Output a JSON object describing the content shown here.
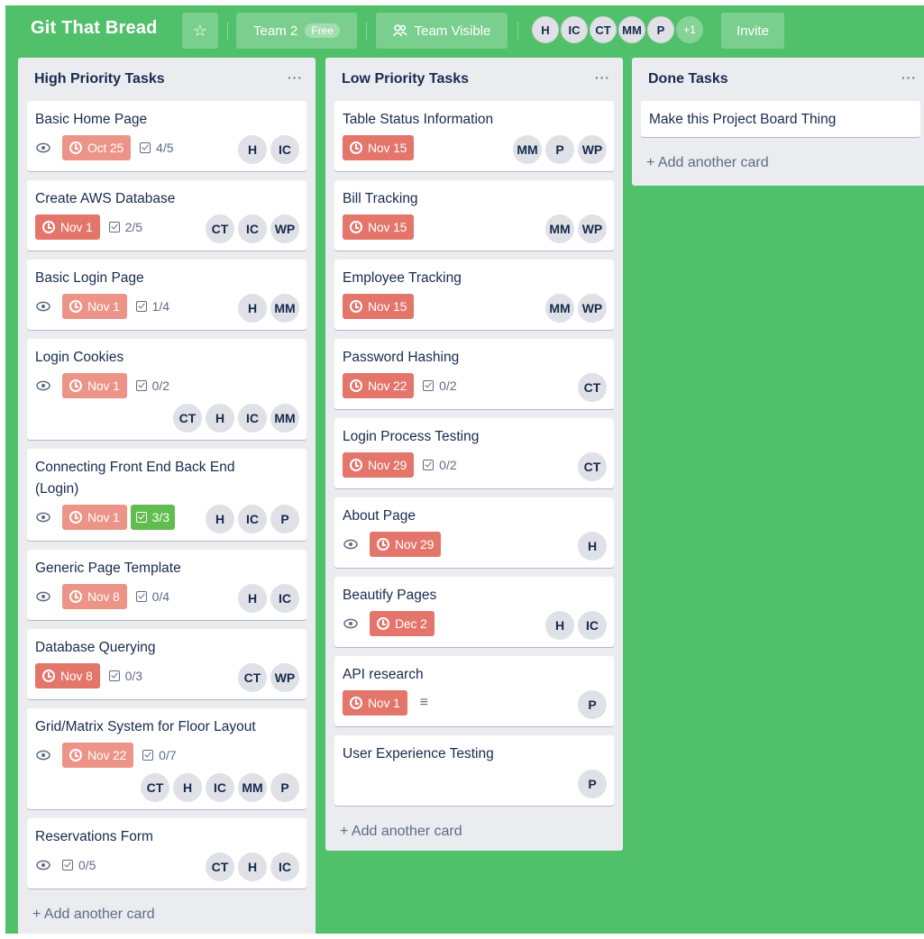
{
  "header": {
    "title": "Git That Bread",
    "team_label": "Team 2",
    "team_badge": "Free",
    "visibility_label": "Team Visible",
    "members": [
      "H",
      "IC",
      "CT",
      "MM",
      "P"
    ],
    "more_members": "+1",
    "invite_label": "Invite"
  },
  "lists": [
    {
      "title": "High Priority Tasks",
      "menu": "···",
      "add_card": "+ Add another card",
      "cards": [
        {
          "title": "Basic Home Page",
          "due": "Oct 25",
          "checklist": "4/5",
          "members": [
            "H",
            "IC"
          ]
        },
        {
          "title": "Create AWS Database",
          "due": "Nov 1",
          "checklist": "2/5",
          "members": [
            "CT",
            "IC",
            "WP"
          ]
        },
        {
          "title": "Basic Login Page",
          "due": "Nov 1",
          "checklist": "1/4",
          "members": [
            "H",
            "MM"
          ]
        },
        {
          "title": "Login Cookies",
          "due": "Nov 1",
          "checklist": "0/2",
          "members": [
            "CT",
            "H",
            "IC",
            "MM"
          ]
        },
        {
          "title": "Connecting Front End Back End (Login)",
          "due": "Nov 1",
          "checklist": "3/3",
          "members": [
            "H",
            "IC",
            "P"
          ]
        },
        {
          "title": "Generic Page Template",
          "due": "Nov 8",
          "checklist": "0/4",
          "members": [
            "H",
            "IC"
          ]
        },
        {
          "title": "Database Querying",
          "due": "Nov 8",
          "checklist": "0/3",
          "members": [
            "CT",
            "WP"
          ]
        },
        {
          "title": "Grid/Matrix System for Floor Layout",
          "due": "Nov 22",
          "checklist": "0/7",
          "members": [
            "CT",
            "H",
            "IC",
            "MM",
            "P"
          ]
        },
        {
          "title": "Reservations Form",
          "checklist": "0/5",
          "members": [
            "CT",
            "H",
            "IC"
          ]
        }
      ]
    },
    {
      "title": "Low Priority Tasks",
      "menu": "···",
      "add_card": "+ Add another card",
      "cards": [
        {
          "title": "Table Status Information",
          "due": "Nov 15",
          "members": [
            "MM",
            "P",
            "WP"
          ]
        },
        {
          "title": "Bill Tracking",
          "due": "Nov 15",
          "members": [
            "MM",
            "WP"
          ]
        },
        {
          "title": "Employee Tracking",
          "due": "Nov 15",
          "members": [
            "MM",
            "WP"
          ]
        },
        {
          "title": "Password Hashing",
          "due": "Nov 22",
          "checklist": "0/2",
          "members": [
            "CT"
          ]
        },
        {
          "title": "Login Process Testing",
          "due": "Nov 29",
          "checklist": "0/2",
          "members": [
            "CT"
          ]
        },
        {
          "title": "About Page",
          "due": "Nov 29",
          "members": [
            "H"
          ]
        },
        {
          "title": "Beautify Pages",
          "due": "Dec 2",
          "members": [
            "H",
            "IC"
          ]
        },
        {
          "title": "API research",
          "due": "Nov 1",
          "members": [
            "P"
          ]
        },
        {
          "title": "User Experience Testing",
          "members": [
            "P"
          ]
        }
      ]
    },
    {
      "title": "Done Tasks",
      "menu": "···",
      "add_card": "+ Add another card",
      "cards": [
        {
          "title": "Make this Project Board Thing"
        }
      ]
    }
  ],
  "colors": {
    "board_bg": "#51c06b",
    "due_overdue": "#ec9488",
    "checklist_complete": "#61bd4f"
  }
}
